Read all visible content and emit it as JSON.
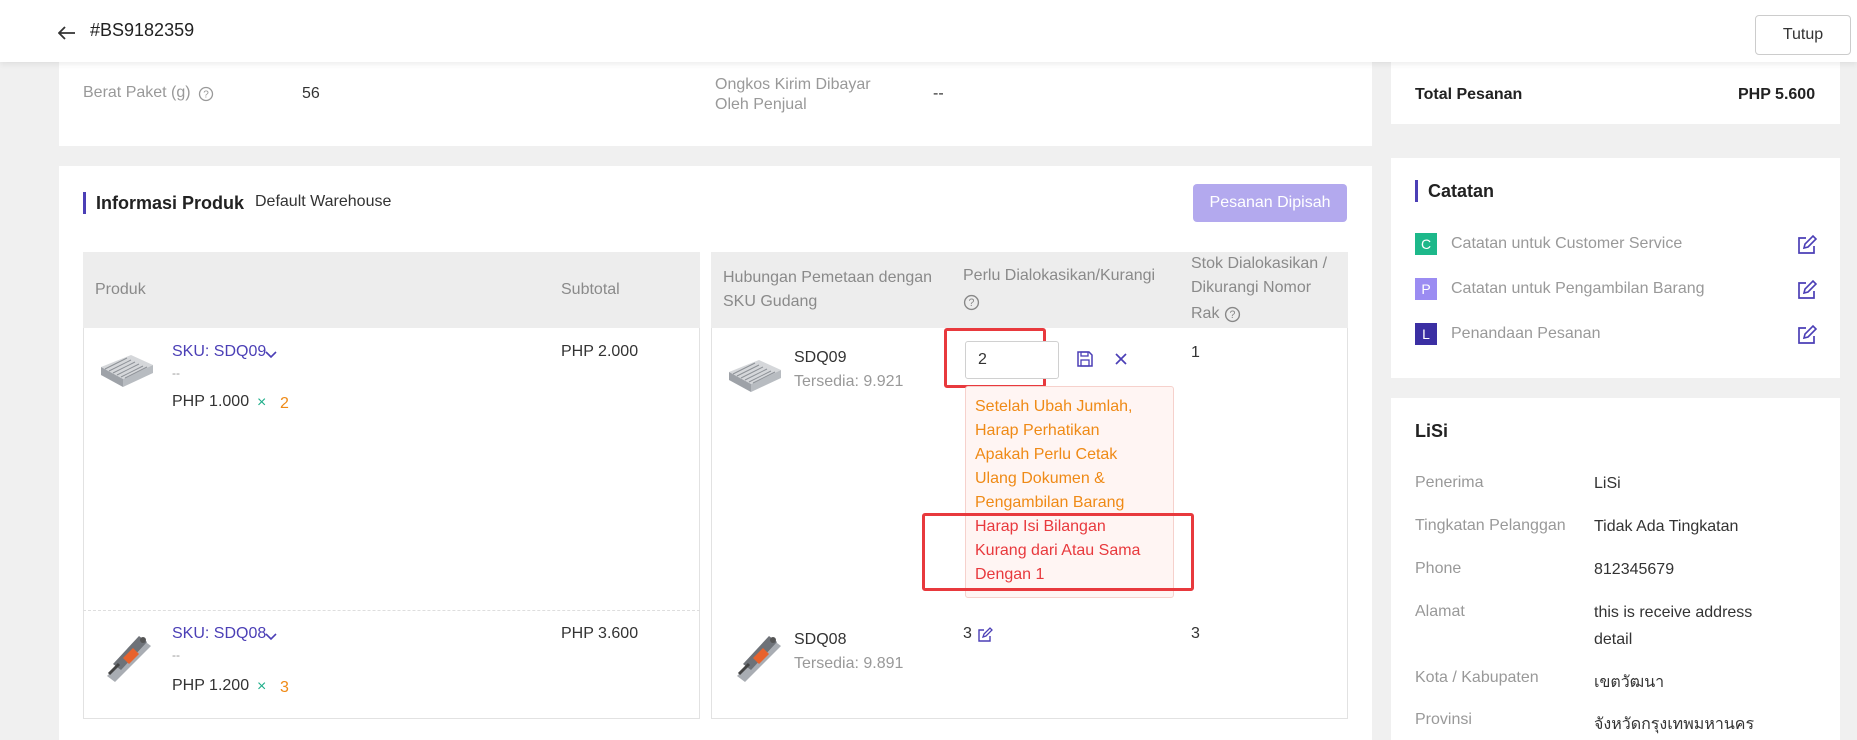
{
  "header": {
    "order_id": "#BS9182359",
    "close_label": "Tutup"
  },
  "package": {
    "weight_label": "Berat Paket (g)",
    "weight_value": "56",
    "shipping_label_line1": "Ongkos Kirim Dibayar",
    "shipping_label_line2": "Oleh Penjual",
    "shipping_value": "--"
  },
  "product_info": {
    "title": "Informasi Produk",
    "warehouse": "Default Warehouse",
    "split_button": "Pesanan Dipisah",
    "columns": {
      "product": "Produk",
      "subtotal": "Subtotal",
      "mapping_line1": "Hubungan Pemetaan dengan",
      "mapping_line2": "SKU Gudang",
      "allocate": "Perlu Dialokasikan/Kurangi",
      "stock_line1": "Stok Dialokasikan /",
      "stock_line2": "Dikurangi Nomor",
      "stock_line3": "Rak"
    },
    "rows": [
      {
        "sku": "SKU: SDQ09",
        "dash": "--",
        "price": "PHP 1.000",
        "x": "×",
        "qty": "2",
        "subtotal": "PHP 2.000",
        "wh_sku": "SDQ09",
        "available": "Tersedia: 9.921",
        "alloc_input": "2",
        "stock": "1"
      },
      {
        "sku": "SKU: SDQ08",
        "dash": "--",
        "price": "PHP 1.200",
        "x": "×",
        "qty": "3",
        "subtotal": "PHP 3.600",
        "wh_sku": "SDQ08",
        "available": "Tersedia: 9.891",
        "alloc_value": "3",
        "stock": "3"
      }
    ],
    "tooltip": {
      "warning": [
        "Setelah Ubah Jumlah,",
        "Harap Perhatikan",
        "Apakah Perlu Cetak",
        "Ulang Dokumen &",
        "Pengambilan Barang"
      ],
      "error": [
        "Harap Isi Bilangan",
        "Kurang dari Atau Sama",
        "Dengan 1"
      ]
    }
  },
  "summary": {
    "total_label": "Total Pesanan",
    "total_value": "PHP 5.600"
  },
  "notes": {
    "title": "Catatan",
    "items": [
      {
        "tag": "C",
        "label": "Catatan untuk Customer Service",
        "color": "#1db88a"
      },
      {
        "tag": "P",
        "label": "Catatan untuk Pengambilan Barang",
        "color": "#9b8cf2"
      },
      {
        "tag": "L",
        "label": "Penandaan Pesanan",
        "color": "#3b2fa3"
      }
    ]
  },
  "customer": {
    "name": "LiSi",
    "fields": [
      {
        "label": "Penerima",
        "value": "LiSi"
      },
      {
        "label": "Tingkatan Pelanggan",
        "value": "Tidak Ada Tingkatan"
      },
      {
        "label": "Phone",
        "value": "812345679"
      },
      {
        "label": "Alamat",
        "value_line1": "this is receive address",
        "value_line2": "detail"
      },
      {
        "label": "Kota / Kabupaten",
        "value": "เขตวัฒนา"
      },
      {
        "label": "Provinsi",
        "value": "จังหวัดกรุงเทพมหานคร"
      }
    ]
  },
  "colors": {
    "accent": "#4b3fb6",
    "button_disabled": "#b3a9ee",
    "warning": "#ef8a16",
    "error": "#e8393d"
  }
}
